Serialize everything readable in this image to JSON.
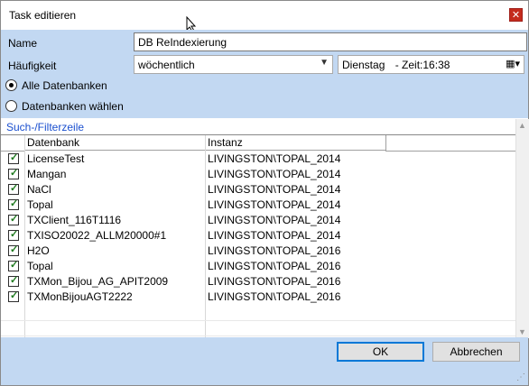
{
  "window": {
    "title": "Task editieren",
    "close_label": "✕"
  },
  "form": {
    "name_label": "Name",
    "name_value": "DB ReIndexierung",
    "freq_label": "Häufigkeit",
    "freq_value": "wöchentlich",
    "day_value": "Dienstag",
    "time_text": "- Zeit:16:38",
    "radio_all": "Alle Datenbanken",
    "radio_choose": "Datenbanken wählen"
  },
  "filter": {
    "label": "Such-/Filterzeile"
  },
  "grid": {
    "columns": [
      "Datenbank",
      "Instanz"
    ],
    "rows": [
      {
        "db": "LicenseTest",
        "inst": "LIVINGSTON\\TOPAL_2014"
      },
      {
        "db": "Mangan",
        "inst": "LIVINGSTON\\TOPAL_2014"
      },
      {
        "db": "NaCl",
        "inst": "LIVINGSTON\\TOPAL_2014"
      },
      {
        "db": "Topal",
        "inst": "LIVINGSTON\\TOPAL_2014"
      },
      {
        "db": "TXClient_116T1116",
        "inst": "LIVINGSTON\\TOPAL_2014"
      },
      {
        "db": "TXISO20022_ALLM20000#1",
        "inst": "LIVINGSTON\\TOPAL_2014"
      },
      {
        "db": "H2O",
        "inst": "LIVINGSTON\\TOPAL_2016"
      },
      {
        "db": "Topal",
        "inst": "LIVINGSTON\\TOPAL_2016"
      },
      {
        "db": "TXMon_Bijou_AG_APIT2009",
        "inst": "LIVINGSTON\\TOPAL_2016"
      },
      {
        "db": "TXMonBijouAGT2222",
        "inst": "LIVINGSTON\\TOPAL_2016"
      }
    ]
  },
  "buttons": {
    "ok": "OK",
    "cancel": "Abbrechen"
  },
  "colors": {
    "panel": "#c2d8f2",
    "close": "#c42b1c",
    "link": "#1a4fcf",
    "check": "#1f7a1f"
  }
}
